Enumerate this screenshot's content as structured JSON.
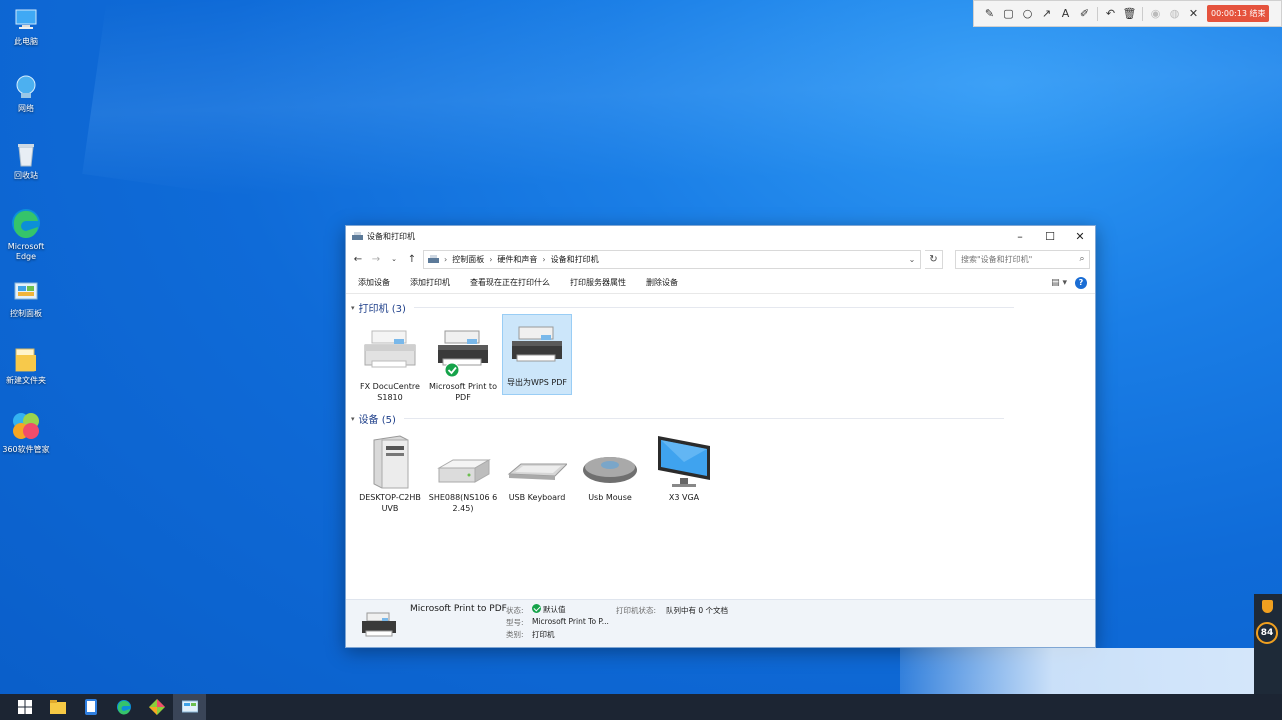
{
  "desktop": {
    "icons": [
      {
        "label": "此电脑",
        "icon": "computer-icon"
      },
      {
        "label": "网络",
        "icon": "network-icon"
      },
      {
        "label": "回收站",
        "icon": "recycle-bin-icon"
      },
      {
        "label": "Microsoft Edge",
        "icon": "edge-icon"
      },
      {
        "label": "控制面板",
        "icon": "control-panel-icon"
      },
      {
        "label": "新建文件夹",
        "icon": "folder-icon"
      },
      {
        "label": "360软件管家",
        "icon": "software-manager-icon"
      }
    ]
  },
  "recorder": {
    "tools": [
      "pencil-icon",
      "rectangle-icon",
      "circle-icon",
      "arrow-icon",
      "text-icon",
      "marker-icon",
      "undo-icon",
      "delete-icon",
      "hide-icon",
      "mosaic-icon",
      "close-icon"
    ],
    "text_tool": "A",
    "timer": "00:00:13 结束"
  },
  "window": {
    "title": "设备和打印机",
    "breadcrumb": [
      "控制面板",
      "硬件和声音",
      "设备和打印机"
    ],
    "search_placeholder": "搜索\"设备和打印机\"",
    "commands": [
      "添加设备",
      "添加打印机",
      "查看现在正在打印什么",
      "打印服务器属性",
      "删除设备"
    ],
    "printers_group": "打印机 (3)",
    "printers": [
      {
        "label": "FX DocuCentre S1810",
        "default": false,
        "selected": false
      },
      {
        "label": "Microsoft Print to PDF",
        "default": true,
        "selected": false
      },
      {
        "label": "导出为WPS PDF",
        "default": false,
        "selected": true
      }
    ],
    "devices_group": "设备 (5)",
    "devices": [
      {
        "label": "DESKTOP-C2HB UVB",
        "icon": "desktop-tower-icon"
      },
      {
        "label": "SHE088(NS106 6 2.45)",
        "icon": "network-device-icon"
      },
      {
        "label": "USB Keyboard",
        "icon": "keyboard-icon"
      },
      {
        "label": "Usb Mouse",
        "icon": "mouse-icon"
      },
      {
        "label": "X3 VGA",
        "icon": "monitor-icon"
      }
    ],
    "details": {
      "name": "Microsoft Print to PDF",
      "status_label": "状态:",
      "status_value": "默认值",
      "model_label": "型号:",
      "model_value": "Microsoft Print To P...",
      "category_label": "类别:",
      "category_value": "打印机",
      "printer_status_label": "打印机状态:",
      "printer_status_value": "队列中有 0 个文档"
    }
  },
  "tray": {
    "badge": "84"
  }
}
